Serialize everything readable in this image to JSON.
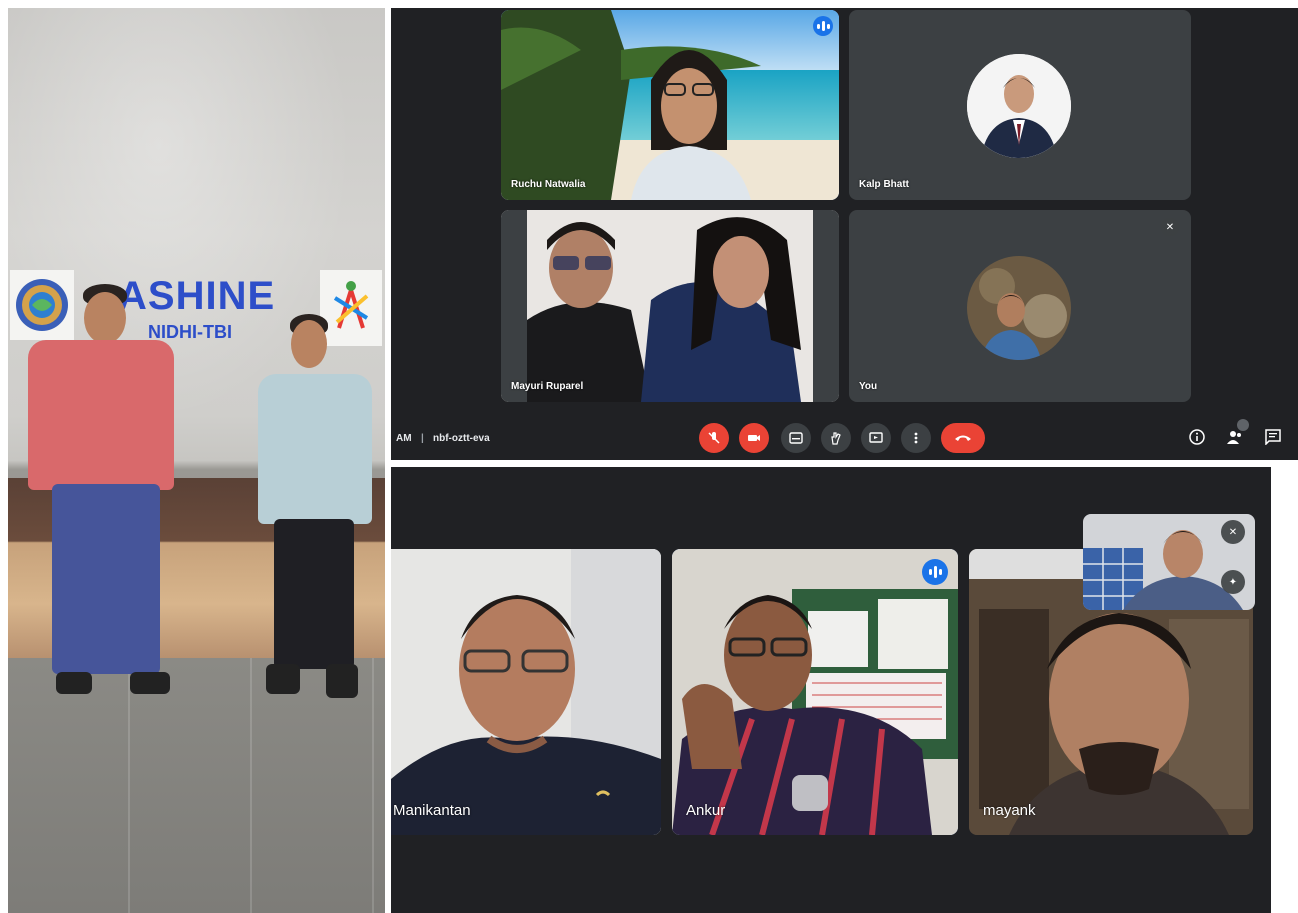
{
  "photo": {
    "brand_title": "ASHINE",
    "brand_subtitle": "NIDHI-TBI"
  },
  "meeting_top": {
    "participants": [
      {
        "name": "Ruchu Natwalia"
      },
      {
        "name": "Kalp Bhatt"
      },
      {
        "name": "Mayuri Ruparel"
      },
      {
        "name": "You"
      }
    ],
    "time_text": "AM",
    "meeting_code": "nbf-oztt-eva",
    "colors": {
      "end_call": "#ea4335",
      "speaking": "#1a73e8",
      "background": "#202124"
    }
  },
  "meeting_bottom": {
    "participants": [
      {
        "name": "Manikantan"
      },
      {
        "name": "Ankur"
      },
      {
        "name": "mayank"
      }
    ]
  }
}
